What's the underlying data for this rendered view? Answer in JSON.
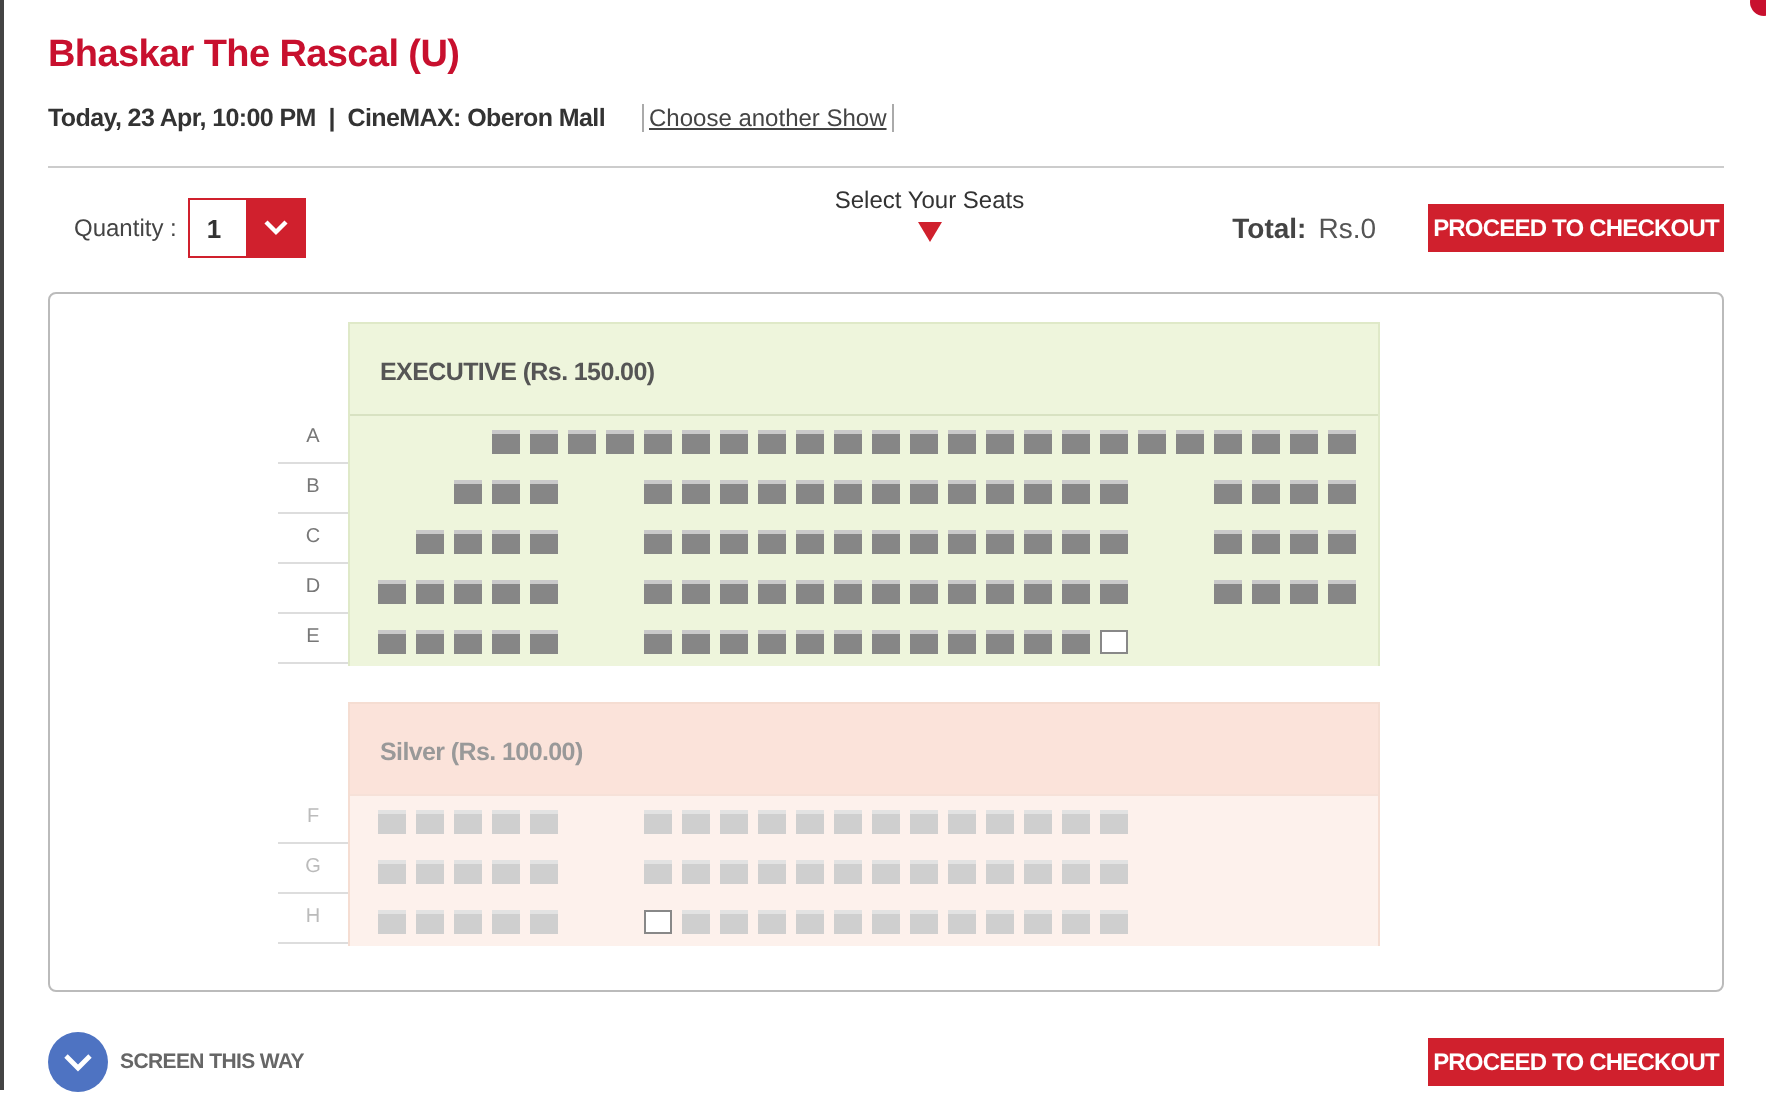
{
  "title": "Bhaskar The Rascal (U)",
  "show_info": "Today, 23 Apr, 10:00 PM  |  CineMAX: Oberon Mall",
  "change_link": "Choose another Show",
  "quantity": {
    "label": "Quantity :",
    "value": "1"
  },
  "select_hint": "Select Your Seats",
  "total": {
    "label": "Total:",
    "value": "Rs.0"
  },
  "checkout_buttons": [
    "PROCEED TO CHECKOUT",
    "PROCEED TO CHECKOUT"
  ],
  "screen_label": "SCREEN THIS WAY",
  "sections": [
    {
      "title": "EXECUTIVE (Rs. 150.00)",
      "rows": [
        {
          "label": "A",
          "seats": [
            {
              "kind": "gap"
            },
            {
              "kind": "gap"
            },
            {
              "kind": "gap"
            },
            {
              "kind": "seat",
              "available": false
            },
            {
              "kind": "seat",
              "available": false
            },
            {
              "kind": "seat",
              "available": false
            },
            {
              "kind": "seat",
              "available": false
            },
            {
              "kind": "seat",
              "available": false
            },
            {
              "kind": "seat",
              "available": false
            },
            {
              "kind": "seat",
              "available": false
            },
            {
              "kind": "seat",
              "available": false
            },
            {
              "kind": "seat",
              "available": false
            },
            {
              "kind": "seat",
              "available": false
            },
            {
              "kind": "seat",
              "available": false
            },
            {
              "kind": "seat",
              "available": false
            },
            {
              "kind": "seat",
              "available": false
            },
            {
              "kind": "seat",
              "available": false
            },
            {
              "kind": "seat",
              "available": false
            },
            {
              "kind": "seat",
              "available": false
            },
            {
              "kind": "seat",
              "available": false
            },
            {
              "kind": "seat",
              "available": false
            },
            {
              "kind": "seat",
              "available": false
            },
            {
              "kind": "seat",
              "available": false
            },
            {
              "kind": "seat",
              "available": false
            },
            {
              "kind": "seat",
              "available": false
            },
            {
              "kind": "seat",
              "available": false
            }
          ]
        },
        {
          "label": "B",
          "seats": [
            {
              "kind": "gap"
            },
            {
              "kind": "gap"
            },
            {
              "kind": "seat",
              "available": false
            },
            {
              "kind": "seat",
              "available": false
            },
            {
              "kind": "seat",
              "available": false
            },
            {
              "kind": "gap"
            },
            {
              "kind": "gap"
            },
            {
              "kind": "seat",
              "available": false
            },
            {
              "kind": "seat",
              "available": false
            },
            {
              "kind": "seat",
              "available": false
            },
            {
              "kind": "seat",
              "available": false
            },
            {
              "kind": "seat",
              "available": false
            },
            {
              "kind": "seat",
              "available": false
            },
            {
              "kind": "seat",
              "available": false
            },
            {
              "kind": "seat",
              "available": false
            },
            {
              "kind": "seat",
              "available": false
            },
            {
              "kind": "seat",
              "available": false
            },
            {
              "kind": "seat",
              "available": false
            },
            {
              "kind": "seat",
              "available": false
            },
            {
              "kind": "seat",
              "available": false
            },
            {
              "kind": "gap"
            },
            {
              "kind": "gap"
            },
            {
              "kind": "seat",
              "available": false
            },
            {
              "kind": "seat",
              "available": false
            },
            {
              "kind": "seat",
              "available": false
            },
            {
              "kind": "seat",
              "available": false
            }
          ]
        },
        {
          "label": "C",
          "seats": [
            {
              "kind": "gap"
            },
            {
              "kind": "seat",
              "available": false
            },
            {
              "kind": "seat",
              "available": false
            },
            {
              "kind": "seat",
              "available": false
            },
            {
              "kind": "seat",
              "available": false
            },
            {
              "kind": "gap"
            },
            {
              "kind": "gap"
            },
            {
              "kind": "seat",
              "available": false
            },
            {
              "kind": "seat",
              "available": false
            },
            {
              "kind": "seat",
              "available": false
            },
            {
              "kind": "seat",
              "available": false
            },
            {
              "kind": "seat",
              "available": false
            },
            {
              "kind": "seat",
              "available": false
            },
            {
              "kind": "seat",
              "available": false
            },
            {
              "kind": "seat",
              "available": false
            },
            {
              "kind": "seat",
              "available": false
            },
            {
              "kind": "seat",
              "available": false
            },
            {
              "kind": "seat",
              "available": false
            },
            {
              "kind": "seat",
              "available": false
            },
            {
              "kind": "seat",
              "available": false
            },
            {
              "kind": "gap"
            },
            {
              "kind": "gap"
            },
            {
              "kind": "seat",
              "available": false
            },
            {
              "kind": "seat",
              "available": false
            },
            {
              "kind": "seat",
              "available": false
            },
            {
              "kind": "seat",
              "available": false
            }
          ]
        },
        {
          "label": "D",
          "seats": [
            {
              "kind": "seat",
              "available": false
            },
            {
              "kind": "seat",
              "available": false
            },
            {
              "kind": "seat",
              "available": false
            },
            {
              "kind": "seat",
              "available": false
            },
            {
              "kind": "seat",
              "available": false
            },
            {
              "kind": "gap"
            },
            {
              "kind": "gap"
            },
            {
              "kind": "seat",
              "available": false
            },
            {
              "kind": "seat",
              "available": false
            },
            {
              "kind": "seat",
              "available": false
            },
            {
              "kind": "seat",
              "available": false
            },
            {
              "kind": "seat",
              "available": false
            },
            {
              "kind": "seat",
              "available": false
            },
            {
              "kind": "seat",
              "available": false
            },
            {
              "kind": "seat",
              "available": false
            },
            {
              "kind": "seat",
              "available": false
            },
            {
              "kind": "seat",
              "available": false
            },
            {
              "kind": "seat",
              "available": false
            },
            {
              "kind": "seat",
              "available": false
            },
            {
              "kind": "seat",
              "available": false
            },
            {
              "kind": "gap"
            },
            {
              "kind": "gap"
            },
            {
              "kind": "seat",
              "available": false
            },
            {
              "kind": "seat",
              "available": false
            },
            {
              "kind": "seat",
              "available": false
            },
            {
              "kind": "seat",
              "available": false
            }
          ]
        },
        {
          "label": "E",
          "seats": [
            {
              "kind": "seat",
              "available": false
            },
            {
              "kind": "seat",
              "available": false
            },
            {
              "kind": "seat",
              "available": false
            },
            {
              "kind": "seat",
              "available": false
            },
            {
              "kind": "seat",
              "available": false
            },
            {
              "kind": "gap"
            },
            {
              "kind": "gap"
            },
            {
              "kind": "seat",
              "available": false
            },
            {
              "kind": "seat",
              "available": false
            },
            {
              "kind": "seat",
              "available": false
            },
            {
              "kind": "seat",
              "available": false
            },
            {
              "kind": "seat",
              "available": false
            },
            {
              "kind": "seat",
              "available": false
            },
            {
              "kind": "seat",
              "available": false
            },
            {
              "kind": "seat",
              "available": false
            },
            {
              "kind": "seat",
              "available": false
            },
            {
              "kind": "seat",
              "available": false
            },
            {
              "kind": "seat",
              "available": false
            },
            {
              "kind": "seat",
              "available": false
            },
            {
              "kind": "seat",
              "available": true
            }
          ]
        }
      ]
    },
    {
      "title": "Silver (Rs. 100.00)",
      "rows": [
        {
          "label": "F",
          "seats": [
            {
              "kind": "seat",
              "available": false
            },
            {
              "kind": "seat",
              "available": false
            },
            {
              "kind": "seat",
              "available": false
            },
            {
              "kind": "seat",
              "available": false
            },
            {
              "kind": "seat",
              "available": false
            },
            {
              "kind": "gap"
            },
            {
              "kind": "gap"
            },
            {
              "kind": "seat",
              "available": false
            },
            {
              "kind": "seat",
              "available": false
            },
            {
              "kind": "seat",
              "available": false
            },
            {
              "kind": "seat",
              "available": false
            },
            {
              "kind": "seat",
              "available": false
            },
            {
              "kind": "seat",
              "available": false
            },
            {
              "kind": "seat",
              "available": false
            },
            {
              "kind": "seat",
              "available": false
            },
            {
              "kind": "seat",
              "available": false
            },
            {
              "kind": "seat",
              "available": false
            },
            {
              "kind": "seat",
              "available": false
            },
            {
              "kind": "seat",
              "available": false
            },
            {
              "kind": "seat",
              "available": false
            }
          ]
        },
        {
          "label": "G",
          "seats": [
            {
              "kind": "seat",
              "available": false
            },
            {
              "kind": "seat",
              "available": false
            },
            {
              "kind": "seat",
              "available": false
            },
            {
              "kind": "seat",
              "available": false
            },
            {
              "kind": "seat",
              "available": false
            },
            {
              "kind": "gap"
            },
            {
              "kind": "gap"
            },
            {
              "kind": "seat",
              "available": false
            },
            {
              "kind": "seat",
              "available": false
            },
            {
              "kind": "seat",
              "available": false
            },
            {
              "kind": "seat",
              "available": false
            },
            {
              "kind": "seat",
              "available": false
            },
            {
              "kind": "seat",
              "available": false
            },
            {
              "kind": "seat",
              "available": false
            },
            {
              "kind": "seat",
              "available": false
            },
            {
              "kind": "seat",
              "available": false
            },
            {
              "kind": "seat",
              "available": false
            },
            {
              "kind": "seat",
              "available": false
            },
            {
              "kind": "seat",
              "available": false
            },
            {
              "kind": "seat",
              "available": false
            }
          ]
        },
        {
          "label": "H",
          "seats": [
            {
              "kind": "seat",
              "available": false
            },
            {
              "kind": "seat",
              "available": false
            },
            {
              "kind": "seat",
              "available": false
            },
            {
              "kind": "seat",
              "available": false
            },
            {
              "kind": "seat",
              "available": false
            },
            {
              "kind": "gap"
            },
            {
              "kind": "gap"
            },
            {
              "kind": "seat",
              "available": true
            },
            {
              "kind": "seat",
              "available": false
            },
            {
              "kind": "seat",
              "available": false
            },
            {
              "kind": "seat",
              "available": false
            },
            {
              "kind": "seat",
              "available": false
            },
            {
              "kind": "seat",
              "available": false
            },
            {
              "kind": "seat",
              "available": false
            },
            {
              "kind": "seat",
              "available": false
            },
            {
              "kind": "seat",
              "available": false
            },
            {
              "kind": "seat",
              "available": false
            },
            {
              "kind": "seat",
              "available": false
            },
            {
              "kind": "seat",
              "available": false
            },
            {
              "kind": "seat",
              "available": false
            }
          ]
        }
      ]
    }
  ]
}
